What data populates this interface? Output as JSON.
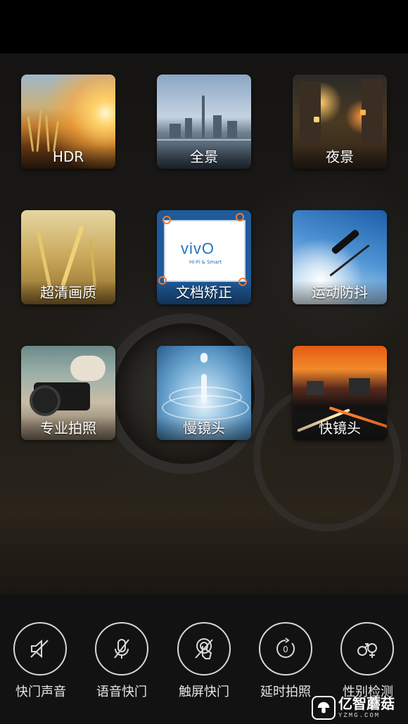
{
  "modes": [
    {
      "id": "hdr",
      "label": "HDR",
      "icon": "hdr-sunset-thumbnail"
    },
    {
      "id": "panorama",
      "label": "全景",
      "icon": "panorama-city-thumbnail"
    },
    {
      "id": "night",
      "label": "夜景",
      "icon": "night-street-thumbnail"
    },
    {
      "id": "ultra-clear",
      "label": "超清画质",
      "icon": "wheat-field-thumbnail"
    },
    {
      "id": "document",
      "label": "文档矫正",
      "icon": "document-thumbnail",
      "logo_text": "vivO",
      "logo_sub": "Hi-Fi & Smart"
    },
    {
      "id": "sport",
      "label": "运动防抖",
      "icon": "skier-thumbnail"
    },
    {
      "id": "pro",
      "label": "专业拍照",
      "icon": "camera-thumbnail"
    },
    {
      "id": "slow-motion",
      "label": "慢镜头",
      "icon": "water-drop-thumbnail"
    },
    {
      "id": "fast-motion",
      "label": "快镜头",
      "icon": "light-trails-thumbnail"
    }
  ],
  "tools": [
    {
      "id": "shutter-sound",
      "label": "快门声音",
      "icon": "speaker-muted-icon"
    },
    {
      "id": "voice-shutter",
      "label": "语音快门",
      "icon": "microphone-off-icon"
    },
    {
      "id": "touch-shutter",
      "label": "触屏快门",
      "icon": "touch-off-icon"
    },
    {
      "id": "timer",
      "label": "延时拍照",
      "icon": "timer-off-icon",
      "value": "0"
    },
    {
      "id": "gender-detect",
      "label": "性别检测",
      "icon": "gender-icon"
    }
  ],
  "watermark": {
    "main": "亿智蘑菇",
    "sub": "YZMG.COM"
  },
  "colors": {
    "accent_orange": "#ff7a2a",
    "panel": "#121212",
    "icon_stroke": "#d8d8d8"
  }
}
